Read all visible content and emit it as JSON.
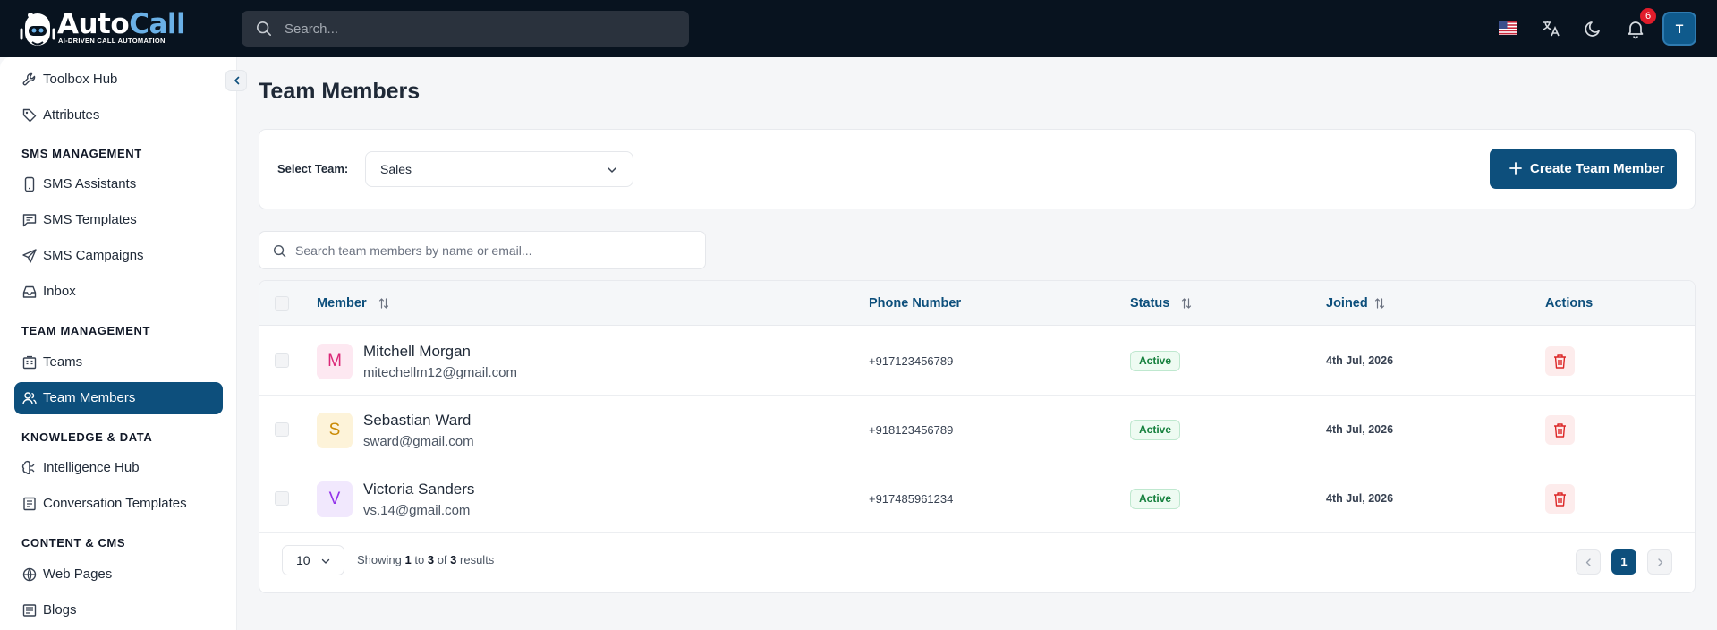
{
  "brand": {
    "name_part1": "Auto",
    "name_part2": "Call",
    "tagline": "AI-DRIVEN CALL AUTOMATION"
  },
  "topbar": {
    "search_placeholder": "Search...",
    "notifications_count": "6",
    "user_initial": "T",
    "icons": [
      "search-icon",
      "us-flag-icon",
      "translate-icon",
      "moon-icon",
      "bell-icon"
    ]
  },
  "sidebar": {
    "top_items": [
      {
        "label": "Toolbox Hub",
        "icon": "wrench-icon"
      },
      {
        "label": "Attributes",
        "icon": "tag-icon"
      }
    ],
    "sections": [
      {
        "title": "SMS MANAGEMENT",
        "items": [
          {
            "label": "SMS Assistants",
            "icon": "phone-icon"
          },
          {
            "label": "SMS Templates",
            "icon": "message-square-icon"
          },
          {
            "label": "SMS Campaigns",
            "icon": "send-icon"
          },
          {
            "label": "Inbox",
            "icon": "inbox-icon"
          }
        ]
      },
      {
        "title": "TEAM MANAGEMENT",
        "items": [
          {
            "label": "Teams",
            "icon": "building-icon"
          },
          {
            "label": "Team Members",
            "icon": "users-icon",
            "active": true
          }
        ]
      },
      {
        "title": "KNOWLEDGE & DATA",
        "items": [
          {
            "label": "Intelligence Hub",
            "icon": "brain-icon"
          },
          {
            "label": "Conversation Templates",
            "icon": "templates-icon"
          }
        ]
      },
      {
        "title": "CONTENT & CMS",
        "items": [
          {
            "label": "Web Pages",
            "icon": "globe-icon"
          },
          {
            "label": "Blogs",
            "icon": "newspaper-icon"
          }
        ]
      }
    ]
  },
  "main": {
    "title": "Team Members",
    "select_team_label": "Select Team:",
    "selected_team": "Sales",
    "create_button_label": "Create Team Member",
    "member_search_placeholder": "Search team members by name or email...",
    "columns": {
      "member": "Member",
      "phone": "Phone Number",
      "status": "Status",
      "joined": "Joined",
      "actions": "Actions"
    },
    "members": [
      {
        "initial": "M",
        "name": "Mitchell Morgan",
        "email": "mitechellm12@gmail.com",
        "phone": "+917123456789",
        "status": "Active",
        "joined": "4th Jul, 2026",
        "avatar_bg": "#fde8f1",
        "avatar_fg": "#db2777"
      },
      {
        "initial": "S",
        "name": "Sebastian Ward",
        "email": "sward@gmail.com",
        "phone": "+918123456789",
        "status": "Active",
        "joined": "4th Jul, 2026",
        "avatar_bg": "#fdf3d9",
        "avatar_fg": "#ca8a04"
      },
      {
        "initial": "V",
        "name": "Victoria Sanders",
        "email": "vs.14@gmail.com",
        "phone": "+917485961234",
        "status": "Active",
        "joined": "4th Jul, 2026",
        "avatar_bg": "#f1e8fd",
        "avatar_fg": "#9333ea"
      }
    ],
    "pagination": {
      "per_page": "10",
      "showing_prefix": "Showing",
      "from": "1",
      "to_word": "to",
      "to": "3",
      "of_word": "of",
      "total": "3",
      "results_word": "results",
      "current_page": "1"
    }
  },
  "colors": {
    "brand_primary": "#0d4f7c",
    "topbar_bg": "#08131f",
    "status_active": "#15803d",
    "danger": "#dc2626"
  }
}
